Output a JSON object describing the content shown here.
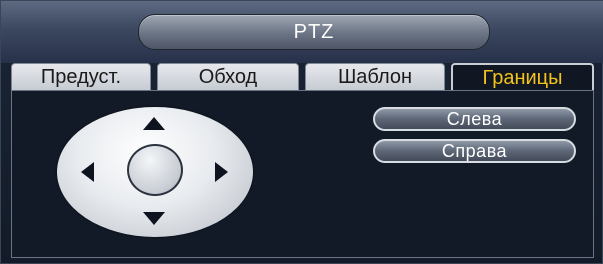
{
  "window": {
    "title": "PTZ"
  },
  "tabs": [
    {
      "label": "Предуст.",
      "active": false
    },
    {
      "label": "Обход",
      "active": false
    },
    {
      "label": "Шаблон",
      "active": false
    },
    {
      "label": "Границы",
      "active": true
    }
  ],
  "limits": {
    "left_button": "Слева",
    "right_button": "Справа"
  },
  "colors": {
    "active_tab_text": "#f4c21a",
    "background": "#121a27"
  },
  "icons": {
    "up": "arrow-up-icon",
    "down": "arrow-down-icon",
    "left": "arrow-left-icon",
    "right": "arrow-right-icon"
  }
}
